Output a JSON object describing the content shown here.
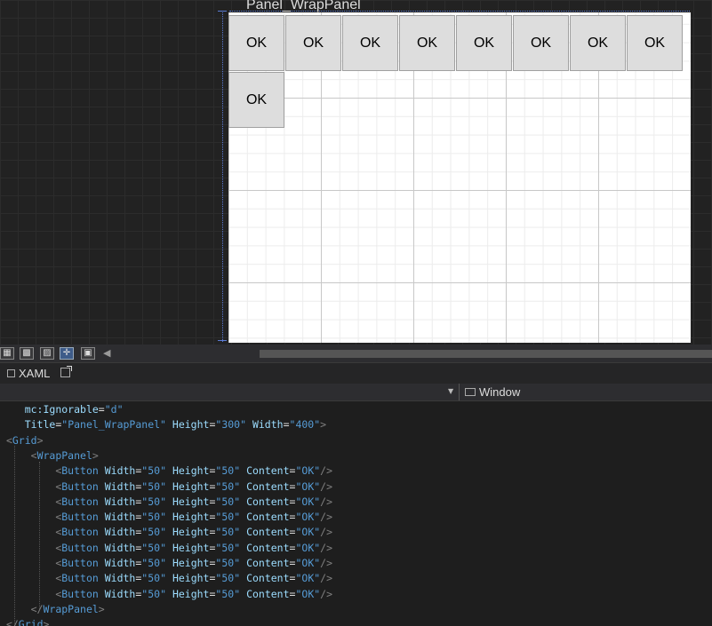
{
  "designer": {
    "window_title": "Panel_WrapPanel",
    "button_label": "OK",
    "button_count": 9
  },
  "toolbar": {
    "view_buttons": [
      "grid-view-icon",
      "snap-grid-icon",
      "pattern-icon",
      "snap-lines-icon",
      "design-toggle-icon"
    ]
  },
  "tabs": {
    "xaml_label": "XAML"
  },
  "element_selector": {
    "value": "Window"
  },
  "code_lines": [
    {
      "indent": "    ",
      "parts": [
        [
          "at",
          "mc:Ignorable"
        ],
        [
          "el",
          "="
        ],
        [
          "vl",
          "\"d\""
        ]
      ]
    },
    {
      "indent": "    ",
      "parts": [
        [
          "at",
          "Title"
        ],
        [
          "el",
          "="
        ],
        [
          "vl",
          "\"Panel_WrapPanel\""
        ],
        [
          "el",
          " "
        ],
        [
          "at",
          "Height"
        ],
        [
          "el",
          "="
        ],
        [
          "vl",
          "\"300\""
        ],
        [
          "el",
          " "
        ],
        [
          "at",
          "Width"
        ],
        [
          "el",
          "="
        ],
        [
          "vl",
          "\"400\""
        ],
        [
          "br",
          ">"
        ]
      ]
    },
    {
      "indent": " ",
      "parts": [
        [
          "br",
          "<"
        ],
        [
          "tg",
          "Grid"
        ],
        [
          "br",
          ">"
        ]
      ]
    },
    {
      "indent": "     ",
      "parts": [
        [
          "br",
          "<"
        ],
        [
          "tg",
          "WrapPanel"
        ],
        [
          "br",
          ">"
        ]
      ]
    },
    {
      "indent": "         ",
      "parts": [
        [
          "br",
          "<"
        ],
        [
          "tg",
          "Button"
        ],
        [
          "el",
          " "
        ],
        [
          "at",
          "Width"
        ],
        [
          "el",
          "="
        ],
        [
          "vl",
          "\"50\""
        ],
        [
          "el",
          " "
        ],
        [
          "at",
          "Height"
        ],
        [
          "el",
          "="
        ],
        [
          "vl",
          "\"50\""
        ],
        [
          "el",
          " "
        ],
        [
          "at",
          "Content"
        ],
        [
          "el",
          "="
        ],
        [
          "vl",
          "\"OK\""
        ],
        [
          "br",
          "/>"
        ]
      ]
    },
    {
      "indent": "         ",
      "parts": [
        [
          "br",
          "<"
        ],
        [
          "tg",
          "Button"
        ],
        [
          "el",
          " "
        ],
        [
          "at",
          "Width"
        ],
        [
          "el",
          "="
        ],
        [
          "vl",
          "\"50\""
        ],
        [
          "el",
          " "
        ],
        [
          "at",
          "Height"
        ],
        [
          "el",
          "="
        ],
        [
          "vl",
          "\"50\""
        ],
        [
          "el",
          " "
        ],
        [
          "at",
          "Content"
        ],
        [
          "el",
          "="
        ],
        [
          "vl",
          "\"OK\""
        ],
        [
          "br",
          "/>"
        ]
      ]
    },
    {
      "indent": "         ",
      "parts": [
        [
          "br",
          "<"
        ],
        [
          "tg",
          "Button"
        ],
        [
          "el",
          " "
        ],
        [
          "at",
          "Width"
        ],
        [
          "el",
          "="
        ],
        [
          "vl",
          "\"50\""
        ],
        [
          "el",
          " "
        ],
        [
          "at",
          "Height"
        ],
        [
          "el",
          "="
        ],
        [
          "vl",
          "\"50\""
        ],
        [
          "el",
          " "
        ],
        [
          "at",
          "Content"
        ],
        [
          "el",
          "="
        ],
        [
          "vl",
          "\"OK\""
        ],
        [
          "br",
          "/>"
        ]
      ]
    },
    {
      "indent": "         ",
      "parts": [
        [
          "br",
          "<"
        ],
        [
          "tg",
          "Button"
        ],
        [
          "el",
          " "
        ],
        [
          "at",
          "Width"
        ],
        [
          "el",
          "="
        ],
        [
          "vl",
          "\"50\""
        ],
        [
          "el",
          " "
        ],
        [
          "at",
          "Height"
        ],
        [
          "el",
          "="
        ],
        [
          "vl",
          "\"50\""
        ],
        [
          "el",
          " "
        ],
        [
          "at",
          "Content"
        ],
        [
          "el",
          "="
        ],
        [
          "vl",
          "\"OK\""
        ],
        [
          "br",
          "/>"
        ]
      ]
    },
    {
      "indent": "         ",
      "parts": [
        [
          "br",
          "<"
        ],
        [
          "tg",
          "Button"
        ],
        [
          "el",
          " "
        ],
        [
          "at",
          "Width"
        ],
        [
          "el",
          "="
        ],
        [
          "vl",
          "\"50\""
        ],
        [
          "el",
          " "
        ],
        [
          "at",
          "Height"
        ],
        [
          "el",
          "="
        ],
        [
          "vl",
          "\"50\""
        ],
        [
          "el",
          " "
        ],
        [
          "at",
          "Content"
        ],
        [
          "el",
          "="
        ],
        [
          "vl",
          "\"OK\""
        ],
        [
          "br",
          "/>"
        ]
      ]
    },
    {
      "indent": "         ",
      "parts": [
        [
          "br",
          "<"
        ],
        [
          "tg",
          "Button"
        ],
        [
          "el",
          " "
        ],
        [
          "at",
          "Width"
        ],
        [
          "el",
          "="
        ],
        [
          "vl",
          "\"50\""
        ],
        [
          "el",
          " "
        ],
        [
          "at",
          "Height"
        ],
        [
          "el",
          "="
        ],
        [
          "vl",
          "\"50\""
        ],
        [
          "el",
          " "
        ],
        [
          "at",
          "Content"
        ],
        [
          "el",
          "="
        ],
        [
          "vl",
          "\"OK\""
        ],
        [
          "br",
          "/>"
        ]
      ]
    },
    {
      "indent": "         ",
      "parts": [
        [
          "br",
          "<"
        ],
        [
          "tg",
          "Button"
        ],
        [
          "el",
          " "
        ],
        [
          "at",
          "Width"
        ],
        [
          "el",
          "="
        ],
        [
          "vl",
          "\"50\""
        ],
        [
          "el",
          " "
        ],
        [
          "at",
          "Height"
        ],
        [
          "el",
          "="
        ],
        [
          "vl",
          "\"50\""
        ],
        [
          "el",
          " "
        ],
        [
          "at",
          "Content"
        ],
        [
          "el",
          "="
        ],
        [
          "vl",
          "\"OK\""
        ],
        [
          "br",
          "/>"
        ]
      ]
    },
    {
      "indent": "         ",
      "parts": [
        [
          "br",
          "<"
        ],
        [
          "tg",
          "Button"
        ],
        [
          "el",
          " "
        ],
        [
          "at",
          "Width"
        ],
        [
          "el",
          "="
        ],
        [
          "vl",
          "\"50\""
        ],
        [
          "el",
          " "
        ],
        [
          "at",
          "Height"
        ],
        [
          "el",
          "="
        ],
        [
          "vl",
          "\"50\""
        ],
        [
          "el",
          " "
        ],
        [
          "at",
          "Content"
        ],
        [
          "el",
          "="
        ],
        [
          "vl",
          "\"OK\""
        ],
        [
          "br",
          "/>"
        ]
      ]
    },
    {
      "indent": "         ",
      "parts": [
        [
          "br",
          "<"
        ],
        [
          "tg",
          "Button"
        ],
        [
          "el",
          " "
        ],
        [
          "at",
          "Width"
        ],
        [
          "el",
          "="
        ],
        [
          "vl",
          "\"50\""
        ],
        [
          "el",
          " "
        ],
        [
          "at",
          "Height"
        ],
        [
          "el",
          "="
        ],
        [
          "vl",
          "\"50\""
        ],
        [
          "el",
          " "
        ],
        [
          "at",
          "Content"
        ],
        [
          "el",
          "="
        ],
        [
          "vl",
          "\"OK\""
        ],
        [
          "br",
          "/>"
        ]
      ]
    },
    {
      "indent": "     ",
      "parts": [
        [
          "br",
          "</"
        ],
        [
          "tg",
          "WrapPanel"
        ],
        [
          "br",
          ">"
        ]
      ]
    },
    {
      "indent": " ",
      "parts": [
        [
          "br",
          "</"
        ],
        [
          "tg",
          "Grid"
        ],
        [
          "br",
          ">"
        ]
      ]
    }
  ]
}
